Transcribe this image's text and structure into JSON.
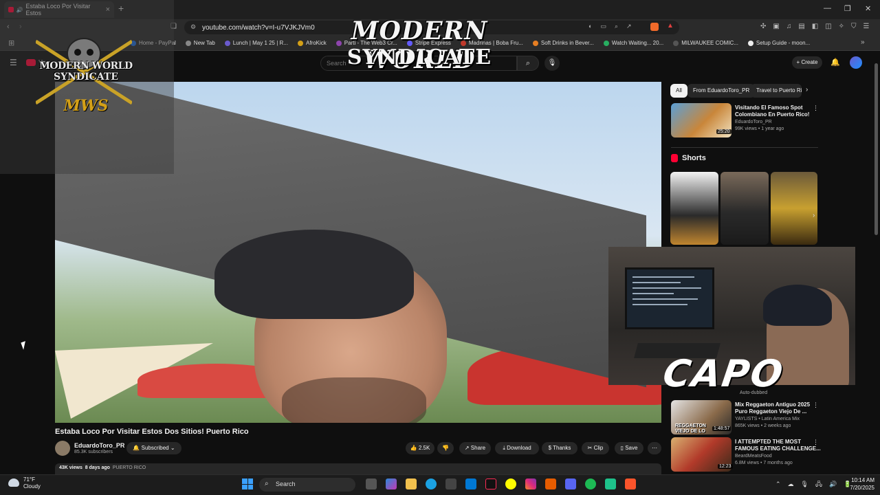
{
  "browser": {
    "tab_title": "Estaba Loco Por Visitar Estos",
    "tab_close": "×",
    "new_tab": "+",
    "address": "youtube.com/watch?v=I-u7VJKJVm0",
    "bookmarks": [
      "Home - PayPal",
      "New Tab",
      "Lunch | May 1 25 | R...",
      "AfroKick",
      "Parti - The Web3 Cr...",
      "Stripe Express",
      "Madrinas | Boba Fru...",
      "Soft Drinks in Bever...",
      "Watch Waiting... 20...",
      "MILWAUKEE COMIC...",
      "Setup Guide - moon..."
    ]
  },
  "youtube": {
    "logo_text": "Yo",
    "search_placeholder": "Search",
    "create_label": "Create"
  },
  "overlay": {
    "logo_line1": "MODERN WORLD",
    "logo_line2": "SYNDICATE",
    "logo_abbr": "MWS",
    "title_line1": "MODERN WORLD",
    "title_line2": "SYNDICATE",
    "webcam_name": "CAPO"
  },
  "video": {
    "title": "Estaba Loco Por Visitar Estos Dos Sitios! Puerto Rico",
    "channel": "EduardoToro_PR",
    "subscribers": "85.3K subscribers",
    "subscribe_state": "Subscribed",
    "likes": "2.5K",
    "share": "Share",
    "download": "Download",
    "thanks": "Thanks",
    "clip": "Clip",
    "save": "Save",
    "more": "⋯",
    "views": "43K views",
    "age": "8 days ago",
    "location_tag": "PUERTO RICO"
  },
  "sidebar": {
    "chips": [
      "All",
      "From EduardoToro_PR",
      "Travel to Puerto Ri"
    ],
    "rec1": {
      "title_l1": "Visitando El Famoso Spot",
      "title_l2": "Colombiano En Puerto Rico!",
      "channel": "EduardoToro_PR",
      "meta": "99K views • 1 year ago",
      "duration": "25:20"
    },
    "shorts_label": "Shorts",
    "rec2": {
      "title_l1": "Mix Reggaeton Antiguo 2025",
      "title_l2": "Puro Reggaeton Viejo De ...",
      "channel": "YAYLISTS • Latin America Mix",
      "meta": "865K views • 2 weeks ago",
      "duration": "1:48:57",
      "thumb_text": "REGGAETON VIEJO DE LO",
      "auto_dubbed": "Auto-dubbed"
    },
    "rec3": {
      "title_l1": "I ATTEMPTED THE MOST",
      "title_l2": "FAMOUS EATING CHALLENGE...",
      "channel": "BeardMeatsFood",
      "meta": "6.8M views • 7 months ago",
      "duration": "12:23"
    }
  },
  "taskbar": {
    "temp": "71°F",
    "condition": "Cloudy",
    "search_label": "Search",
    "time": "10:14 AM",
    "date": "7/20/2025"
  },
  "colors": {
    "accent": "#ff0033",
    "bg": "#0f0f0f",
    "chip": "#272727"
  }
}
